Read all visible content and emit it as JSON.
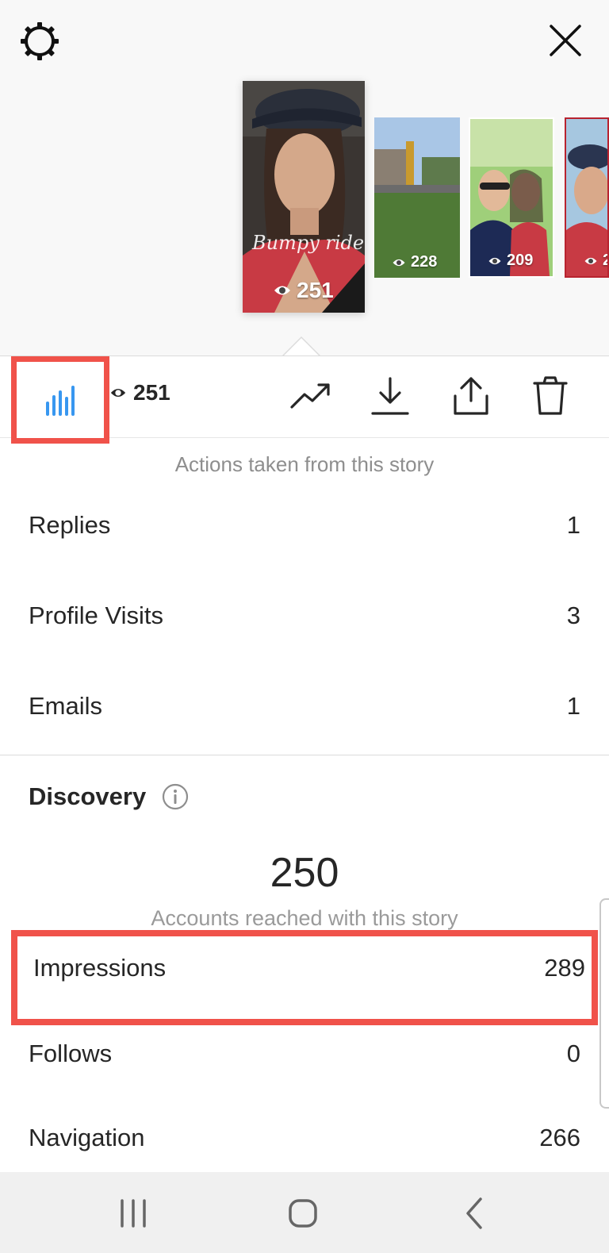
{
  "header": {
    "settings_icon": "gear-icon",
    "close_icon": "close-icon"
  },
  "stories": [
    {
      "views": "251",
      "caption": "Bumpy ride"
    },
    {
      "views": "228"
    },
    {
      "views": "209"
    },
    {
      "views": "2"
    }
  ],
  "toolbar": {
    "insights_icon": "bar-chart-icon",
    "view_count": "251",
    "icons": [
      "trend-icon",
      "download-icon",
      "share-icon",
      "trash-icon"
    ]
  },
  "actions": {
    "caption": "Actions taken from this story",
    "rows": [
      {
        "label": "Replies",
        "value": "1"
      },
      {
        "label": "Profile Visits",
        "value": "3"
      },
      {
        "label": "Emails",
        "value": "1"
      }
    ]
  },
  "discovery": {
    "title": "Discovery",
    "info_icon": "info-icon",
    "accounts_reached": "250",
    "accounts_caption": "Accounts reached with this story",
    "rows": [
      {
        "label": "Impressions",
        "value": "289"
      },
      {
        "label": "Follows",
        "value": "0"
      },
      {
        "label": "Navigation",
        "value": "266"
      }
    ]
  },
  "colors": {
    "accent_blue": "#3897f0",
    "highlight_red": "#f0524a"
  },
  "navbar": {
    "icons": [
      "recent-apps-icon",
      "home-icon",
      "back-icon"
    ]
  }
}
